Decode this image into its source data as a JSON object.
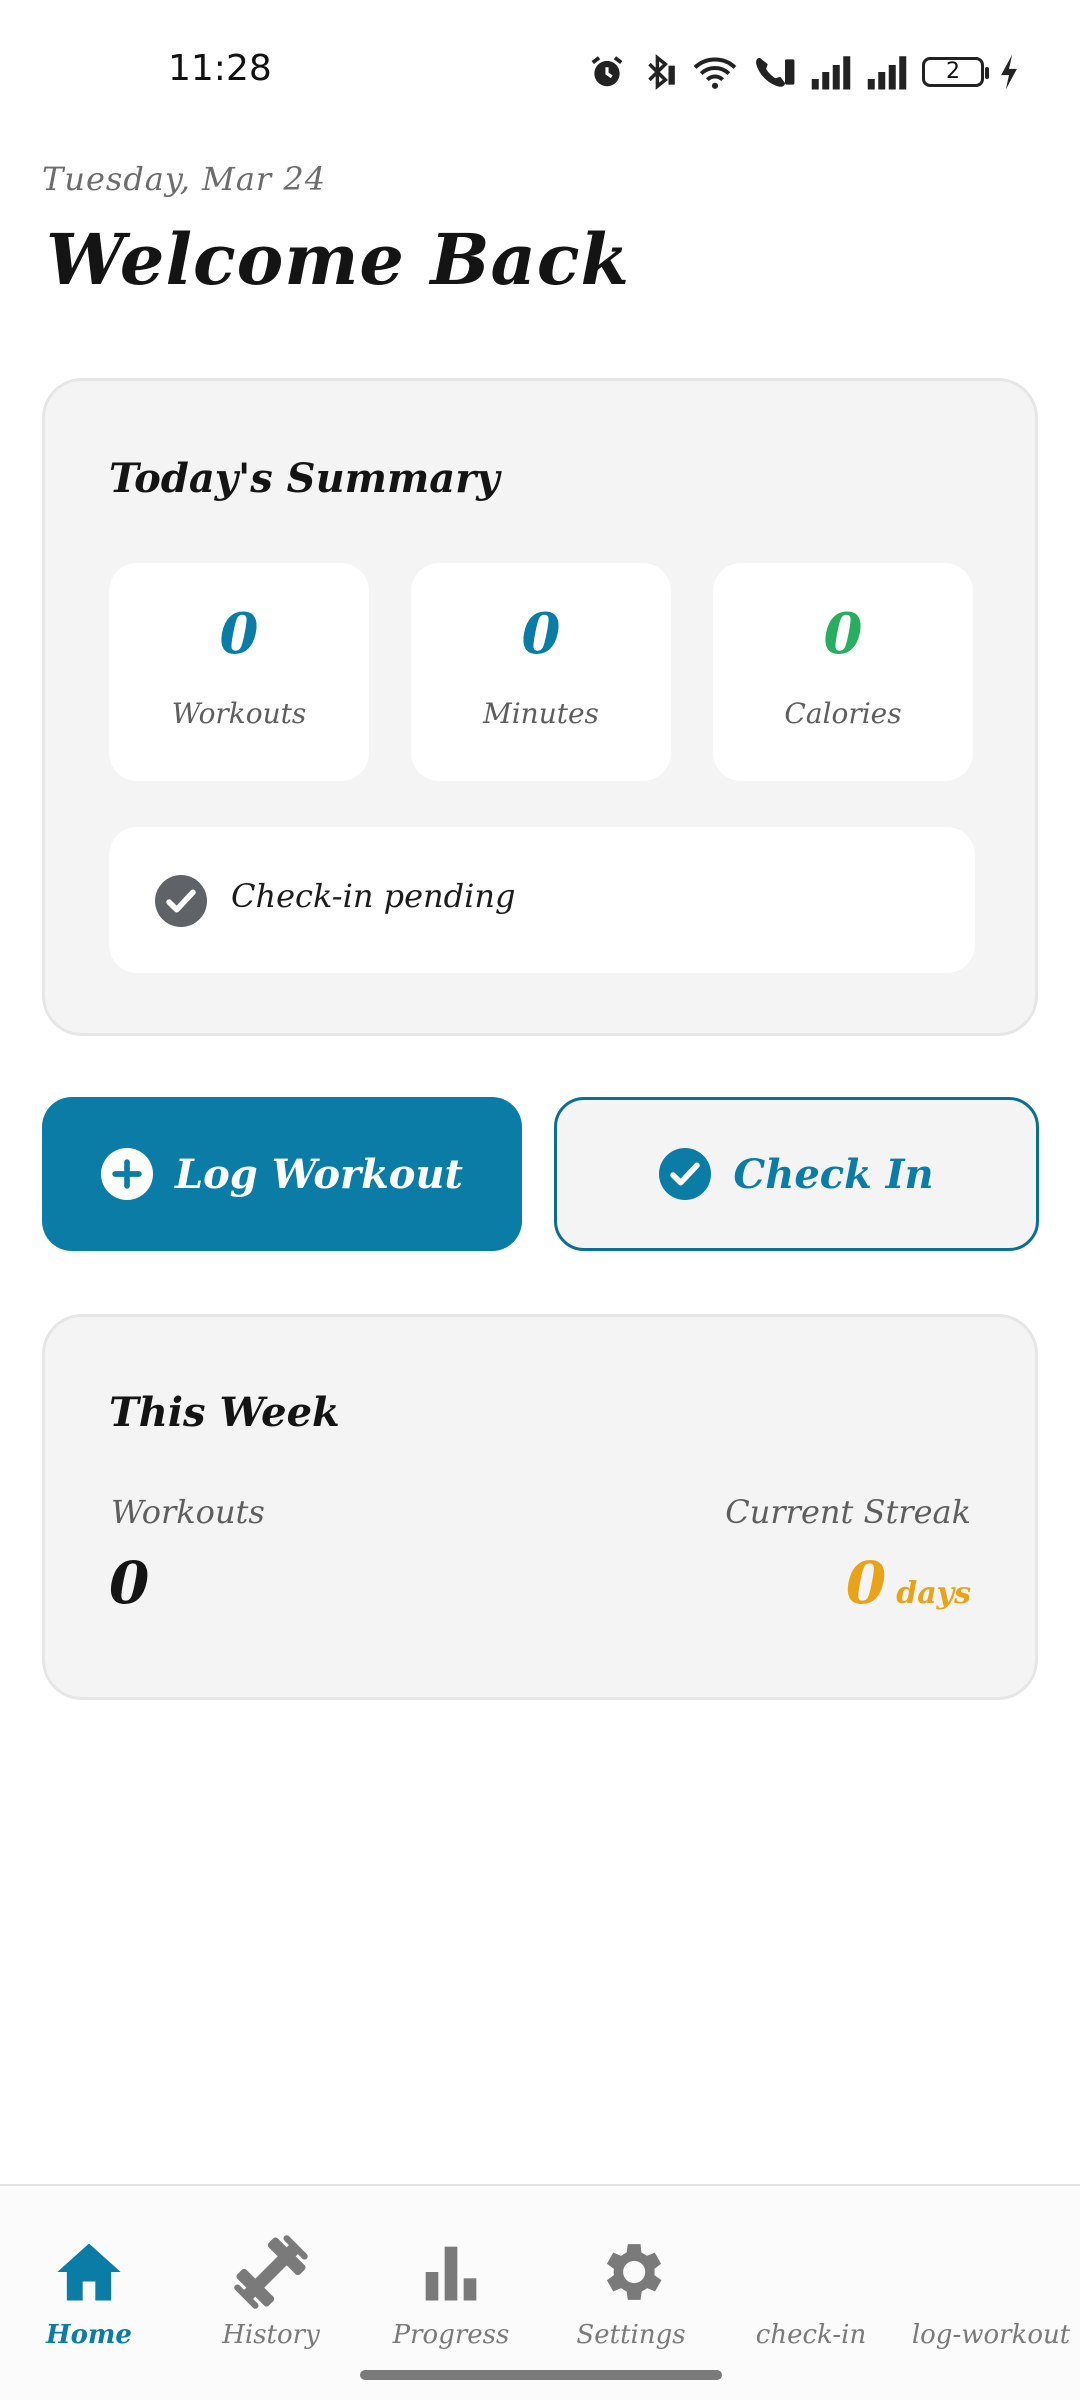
{
  "status_bar": {
    "time": "11:28",
    "battery_level": "2"
  },
  "header": {
    "date": "Tuesday, Mar 24",
    "title": "Welcome Back"
  },
  "summary": {
    "title": "Today's Summary",
    "stats": [
      {
        "value": "0",
        "label": "Workouts",
        "color": "#0a7ca6"
      },
      {
        "value": "0",
        "label": "Minutes",
        "color": "#0a7ca6"
      },
      {
        "value": "0",
        "label": "Calories",
        "color": "#27ae60"
      }
    ],
    "checkin_status": "Check-in pending"
  },
  "actions": {
    "log_workout": "Log Workout",
    "check_in": "Check In"
  },
  "week": {
    "title": "This Week",
    "workouts_label": "Workouts",
    "workouts_value": "0",
    "streak_label": "Current Streak",
    "streak_value": "0",
    "streak_unit": "days"
  },
  "nav": {
    "items": [
      {
        "label": "Home",
        "icon": "home-icon",
        "active": true
      },
      {
        "label": "History",
        "icon": "dumbbell-icon"
      },
      {
        "label": "Progress",
        "icon": "bar-chart-icon"
      },
      {
        "label": "Settings",
        "icon": "gear-icon"
      },
      {
        "label": "check-in"
      },
      {
        "label": "log-workout"
      }
    ]
  },
  "colors": {
    "primary": "#0a7ca6",
    "accent_green": "#27ae60",
    "streak_orange": "#e8a318"
  }
}
